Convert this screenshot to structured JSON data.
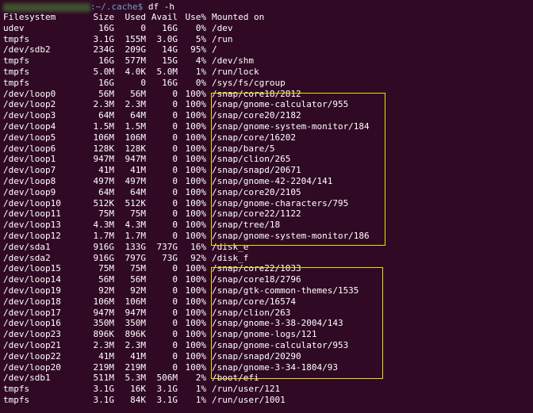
{
  "prompt": {
    "path": ":~/.cache$",
    "command": "df -h"
  },
  "highlight_color": "#e8e000",
  "headers": [
    "Filesystem",
    "Size",
    "Used",
    "Avail",
    "Use%",
    "Mounted on"
  ],
  "rows": [
    [
      "udev",
      "16G",
      "0",
      "16G",
      "0%",
      "/dev"
    ],
    [
      "tmpfs",
      "3.1G",
      "155M",
      "3.0G",
      "5%",
      "/run"
    ],
    [
      "/dev/sdb2",
      "234G",
      "209G",
      "14G",
      "95%",
      "/"
    ],
    [
      "tmpfs",
      "16G",
      "577M",
      "15G",
      "4%",
      "/dev/shm"
    ],
    [
      "tmpfs",
      "5.0M",
      "4.0K",
      "5.0M",
      "1%",
      "/run/lock"
    ],
    [
      "tmpfs",
      "16G",
      "0",
      "16G",
      "0%",
      "/sys/fs/cgroup"
    ],
    [
      "/dev/loop0",
      "56M",
      "56M",
      "0",
      "100%",
      "/snap/core18/2812"
    ],
    [
      "/dev/loop2",
      "2.3M",
      "2.3M",
      "0",
      "100%",
      "/snap/gnome-calculator/955"
    ],
    [
      "/dev/loop3",
      "64M",
      "64M",
      "0",
      "100%",
      "/snap/core20/2182"
    ],
    [
      "/dev/loop4",
      "1.5M",
      "1.5M",
      "0",
      "100%",
      "/snap/gnome-system-monitor/184"
    ],
    [
      "/dev/loop5",
      "106M",
      "106M",
      "0",
      "100%",
      "/snap/core/16202"
    ],
    [
      "/dev/loop6",
      "128K",
      "128K",
      "0",
      "100%",
      "/snap/bare/5"
    ],
    [
      "/dev/loop1",
      "947M",
      "947M",
      "0",
      "100%",
      "/snap/clion/265"
    ],
    [
      "/dev/loop7",
      "41M",
      "41M",
      "0",
      "100%",
      "/snap/snapd/20671"
    ],
    [
      "/dev/loop8",
      "497M",
      "497M",
      "0",
      "100%",
      "/snap/gnome-42-2204/141"
    ],
    [
      "/dev/loop9",
      "64M",
      "64M",
      "0",
      "100%",
      "/snap/core20/2105"
    ],
    [
      "/dev/loop10",
      "512K",
      "512K",
      "0",
      "100%",
      "/snap/gnome-characters/795"
    ],
    [
      "/dev/loop11",
      "75M",
      "75M",
      "0",
      "100%",
      "/snap/core22/1122"
    ],
    [
      "/dev/loop13",
      "4.3M",
      "4.3M",
      "0",
      "100%",
      "/snap/tree/18"
    ],
    [
      "/dev/loop12",
      "1.7M",
      "1.7M",
      "0",
      "100%",
      "/snap/gnome-system-monitor/186"
    ],
    [
      "/dev/sda1",
      "916G",
      "133G",
      "737G",
      "16%",
      "/disk_e"
    ],
    [
      "/dev/sda2",
      "916G",
      "797G",
      "73G",
      "92%",
      "/disk_f"
    ],
    [
      "/dev/loop15",
      "75M",
      "75M",
      "0",
      "100%",
      "/snap/core22/1033"
    ],
    [
      "/dev/loop14",
      "56M",
      "56M",
      "0",
      "100%",
      "/snap/core18/2796"
    ],
    [
      "/dev/loop19",
      "92M",
      "92M",
      "0",
      "100%",
      "/snap/gtk-common-themes/1535"
    ],
    [
      "/dev/loop18",
      "106M",
      "106M",
      "0",
      "100%",
      "/snap/core/16574"
    ],
    [
      "/dev/loop17",
      "947M",
      "947M",
      "0",
      "100%",
      "/snap/clion/263"
    ],
    [
      "/dev/loop16",
      "350M",
      "350M",
      "0",
      "100%",
      "/snap/gnome-3-38-2004/143"
    ],
    [
      "/dev/loop23",
      "896K",
      "896K",
      "0",
      "100%",
      "/snap/gnome-logs/121"
    ],
    [
      "/dev/loop21",
      "2.3M",
      "2.3M",
      "0",
      "100%",
      "/snap/gnome-calculator/953"
    ],
    [
      "/dev/loop22",
      "41M",
      "41M",
      "0",
      "100%",
      "/snap/snapd/20290"
    ],
    [
      "/dev/loop20",
      "219M",
      "219M",
      "0",
      "100%",
      "/snap/gnome-3-34-1804/93"
    ],
    [
      "/dev/sdb1",
      "511M",
      "5.3M",
      "506M",
      "2%",
      "/boot/efi"
    ],
    [
      "tmpfs",
      "3.1G",
      "16K",
      "3.1G",
      "1%",
      "/run/user/121"
    ],
    [
      "tmpfs",
      "3.1G",
      "84K",
      "3.1G",
      "1%",
      "/run/user/1001"
    ]
  ]
}
